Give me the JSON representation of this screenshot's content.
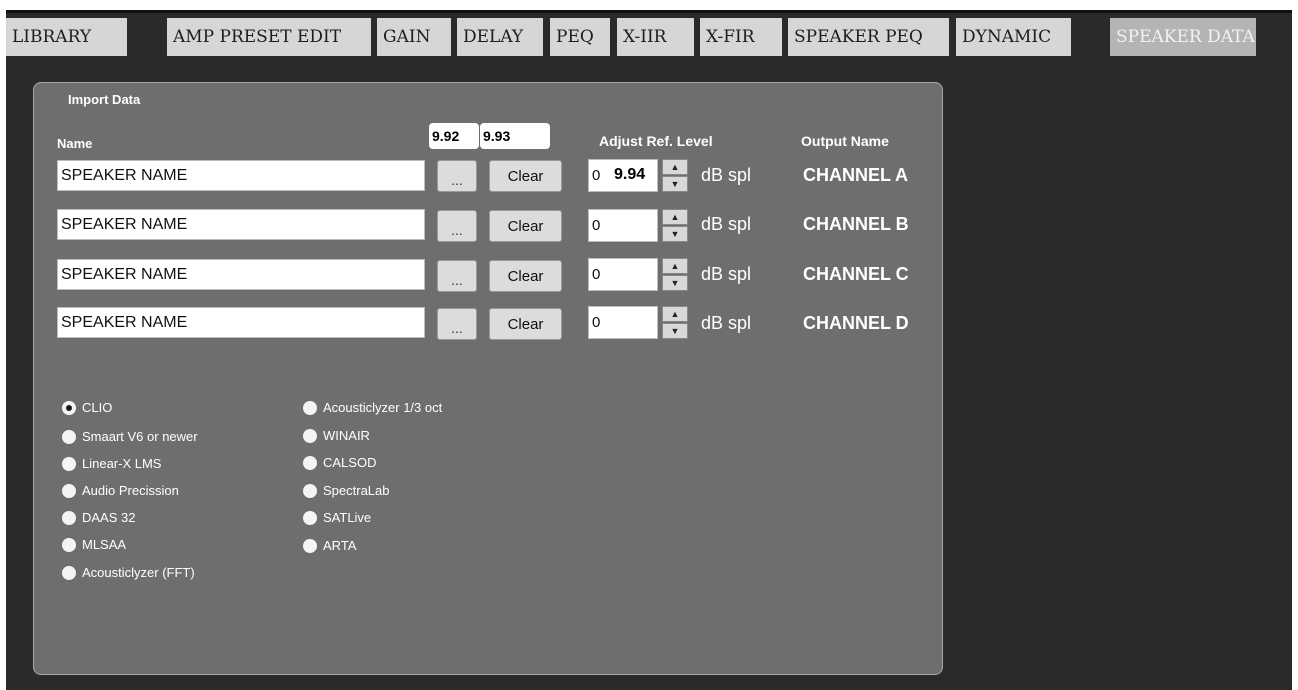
{
  "tabs": [
    {
      "label": "LIBRARY",
      "active": false
    },
    {
      "label": "AMP PRESET EDIT",
      "active": false
    },
    {
      "label": "GAIN",
      "active": false
    },
    {
      "label": "DELAY",
      "active": false
    },
    {
      "label": "PEQ",
      "active": false
    },
    {
      "label": "X-IIR",
      "active": false
    },
    {
      "label": "X-FIR",
      "active": false
    },
    {
      "label": "SPEAKER PEQ",
      "active": false
    },
    {
      "label": "DYNAMIC",
      "active": false
    },
    {
      "label": "SPEAKER DATA",
      "active": true
    }
  ],
  "panel": {
    "title": "Import Data",
    "headers": {
      "name": "Name",
      "adjust_ref_level": "Adjust Ref. Level",
      "output_name": "Output Name"
    },
    "overlay_values": {
      "label_a": "9.92",
      "label_b": "9.93",
      "label_c": "9.94"
    },
    "rows": [
      {
        "speaker_name": "SPEAKER NAME",
        "browse_label": "...",
        "clear_label": "Clear",
        "ref_level": "0",
        "unit": "dB spl",
        "output": "CHANNEL A"
      },
      {
        "speaker_name": "SPEAKER NAME",
        "browse_label": "...",
        "clear_label": "Clear",
        "ref_level": "0",
        "unit": "dB spl",
        "output": "CHANNEL B"
      },
      {
        "speaker_name": "SPEAKER NAME",
        "browse_label": "...",
        "clear_label": "Clear",
        "ref_level": "0",
        "unit": "dB spl",
        "output": "CHANNEL C"
      },
      {
        "speaker_name": "SPEAKER NAME",
        "browse_label": "...",
        "clear_label": "Clear",
        "ref_level": "0",
        "unit": "dB spl",
        "output": "CHANNEL D"
      }
    ],
    "formats_col1": [
      "CLIO",
      "Smaart V6 or newer",
      "Linear-X LMS",
      "Audio Precission",
      "DAAS 32",
      "MLSAA",
      "Acousticlyzer (FFT)"
    ],
    "formats_col2": [
      "Acousticlyzer 1/3 oct",
      "WINAIR",
      "CALSOD",
      "SpectraLab",
      "SATLive",
      "ARTA"
    ],
    "selected_format": "CLIO"
  },
  "colors": {
    "background": "#2a2a2a",
    "panel": "#6e6e6e",
    "tab": "#d6d6d6",
    "tab_active": "#b4b4b4"
  }
}
